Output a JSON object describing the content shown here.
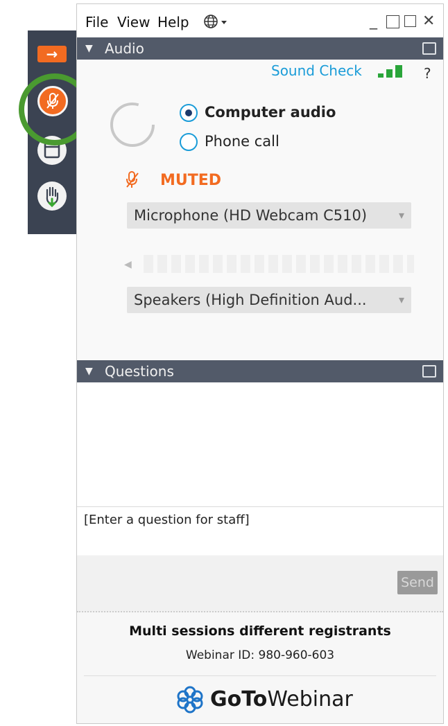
{
  "menu": {
    "file": "File",
    "view": "View",
    "help": "Help"
  },
  "audio": {
    "header": "Audio",
    "sound_check": "Sound Check",
    "options": [
      {
        "label": "Computer audio",
        "selected": true
      },
      {
        "label": "Phone call",
        "selected": false
      }
    ],
    "status": "MUTED",
    "microphone": "Microphone (HD Webcam C510)",
    "speakers": "Speakers (High Definition Aud..."
  },
  "questions": {
    "header": "Questions",
    "placeholder": "[Enter a question for staff]",
    "send_label": "Send"
  },
  "session": {
    "title": "Multi sessions different registrants",
    "webinar_id": "Webinar ID: 980-960-603"
  },
  "brand": {
    "bold": "GoTo",
    "regular": "Webinar"
  },
  "colors": {
    "accent_orange": "#f26b21",
    "link_blue": "#1a9cd8",
    "header_gray": "#525a69",
    "highlight_green": "#4a9a30"
  },
  "icons": [
    "arrow-right-icon",
    "microphone-muted-icon",
    "window-icon",
    "raise-hand-icon",
    "globe-icon",
    "signal-bars-icon",
    "help-icon",
    "popout-icon",
    "speaker-icon"
  ]
}
